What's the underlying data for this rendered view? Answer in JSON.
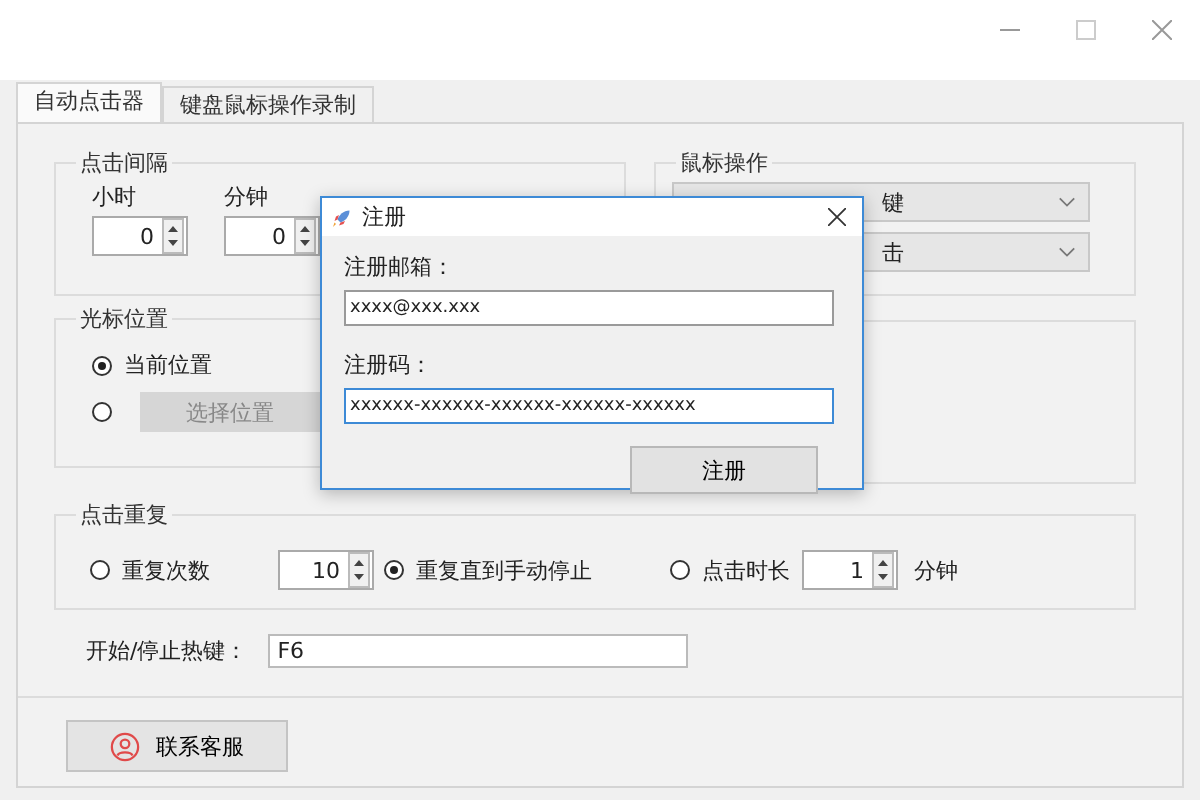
{
  "tabs": [
    {
      "label": "自动点击器",
      "selected": true
    },
    {
      "label": "键盘鼠标操作录制",
      "selected": false
    }
  ],
  "interval": {
    "title": "点击间隔",
    "fields": [
      {
        "label": "小时",
        "value": "0"
      },
      {
        "label": "分钟",
        "value": "0"
      }
    ]
  },
  "mouse": {
    "title": "鼠标操作",
    "selects": [
      "键",
      "击"
    ]
  },
  "cursor": {
    "title": "光标位置",
    "options": [
      {
        "kind": "radio",
        "label": "当前位置",
        "selected": true
      },
      {
        "kind": "button",
        "label": "选择位置",
        "selected": false,
        "disabled": true
      }
    ]
  },
  "repeat": {
    "title": "点击重复",
    "options": [
      {
        "label": "重复次数",
        "selected": false,
        "value": "10"
      },
      {
        "label": "重复直到手动停止",
        "selected": true
      },
      {
        "label": "点击时长",
        "selected": false,
        "value": "1",
        "unit": "分钟"
      }
    ]
  },
  "hotkey": {
    "label": "开始/停止热键：",
    "value": "F6"
  },
  "contact_button": "联系客服",
  "dialog": {
    "title": "注册",
    "fields": [
      {
        "label": "注册邮箱：",
        "value": "xxxx@xxx.xxx",
        "focused": false
      },
      {
        "label": "注册码：",
        "value": "xxxxxx-xxxxxx-xxxxxx-xxxxxx-xxxxxx",
        "focused": true
      }
    ],
    "button": "注册"
  }
}
